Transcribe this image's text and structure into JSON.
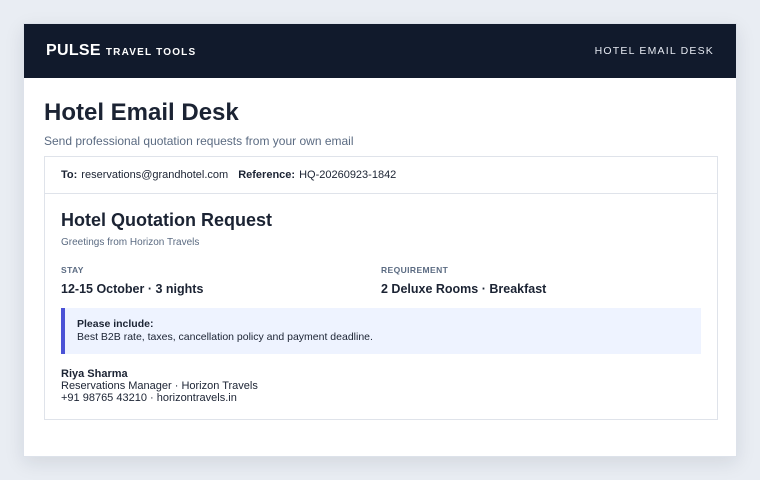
{
  "header": {
    "brand_name": "PULSE",
    "brand_sub": "TRAVEL TOOLS",
    "nav_label": "HOTEL EMAIL DESK"
  },
  "page": {
    "title": "Hotel Email Desk",
    "subtitle": "Send professional quotation requests from your own email"
  },
  "email": {
    "to_label": "To:",
    "to_value": "reservations@grandhotel.com",
    "ref_label": "Reference:",
    "ref_value": "HQ-20260923-1842",
    "title": "Hotel Quotation Request",
    "greeting": "Greetings from Horizon Travels",
    "stay_label": "STAY",
    "stay_value": "12-15 October · 3 nights",
    "requirement_label": "REQUIREMENT",
    "requirement_value": "2 Deluxe Rooms · Breakfast",
    "note_title": "Please include:",
    "note_text": "Best B2B rate, taxes, cancellation policy and payment deadline.",
    "signature": {
      "name": "Riya Sharma",
      "role": "Reservations Manager · Horizon Travels",
      "contact": "+91 98765 43210 · horizontravels.in"
    }
  },
  "colors": {
    "topbar_bg": "#111a2c",
    "accent": "#4b52d6",
    "note_bg": "#eef3ff"
  }
}
